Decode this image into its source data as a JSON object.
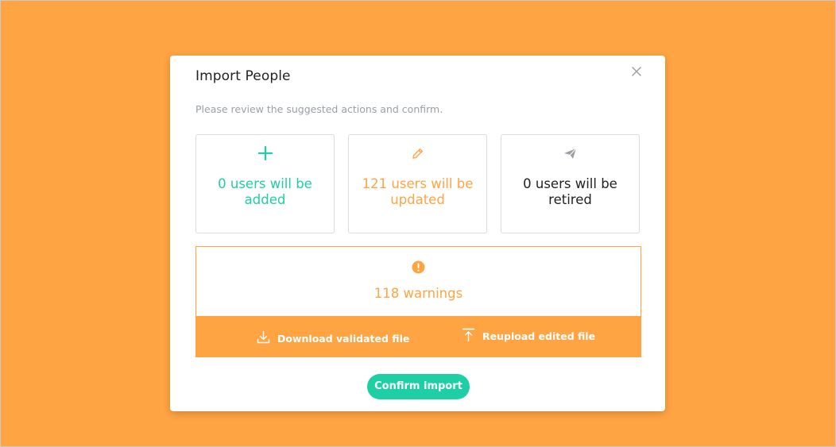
{
  "modal": {
    "title": "Import People",
    "subtitle": "Please review the suggested actions and confirm.",
    "close_icon": "close-icon"
  },
  "cards": [
    {
      "icon": "plus-icon",
      "label": "0 users will be added",
      "color": "#1ECFA6"
    },
    {
      "icon": "pencil-icon",
      "label": "121 users will be updated",
      "color": "#FFA443"
    },
    {
      "icon": "paper-plane-icon",
      "label": "0 users will be retired",
      "color": "#222222"
    }
  ],
  "warnings": {
    "icon": "warning-icon",
    "label": "118 warnings",
    "download_label": "Download validated file",
    "download_icon": "download-icon",
    "reupload_label": "Reupload edited file",
    "reupload_icon": "upload-icon"
  },
  "confirm_label": "Confirm import",
  "colors": {
    "background": "#FFA443",
    "accent_green": "#1ECFA6",
    "accent_orange": "#FFA443"
  }
}
